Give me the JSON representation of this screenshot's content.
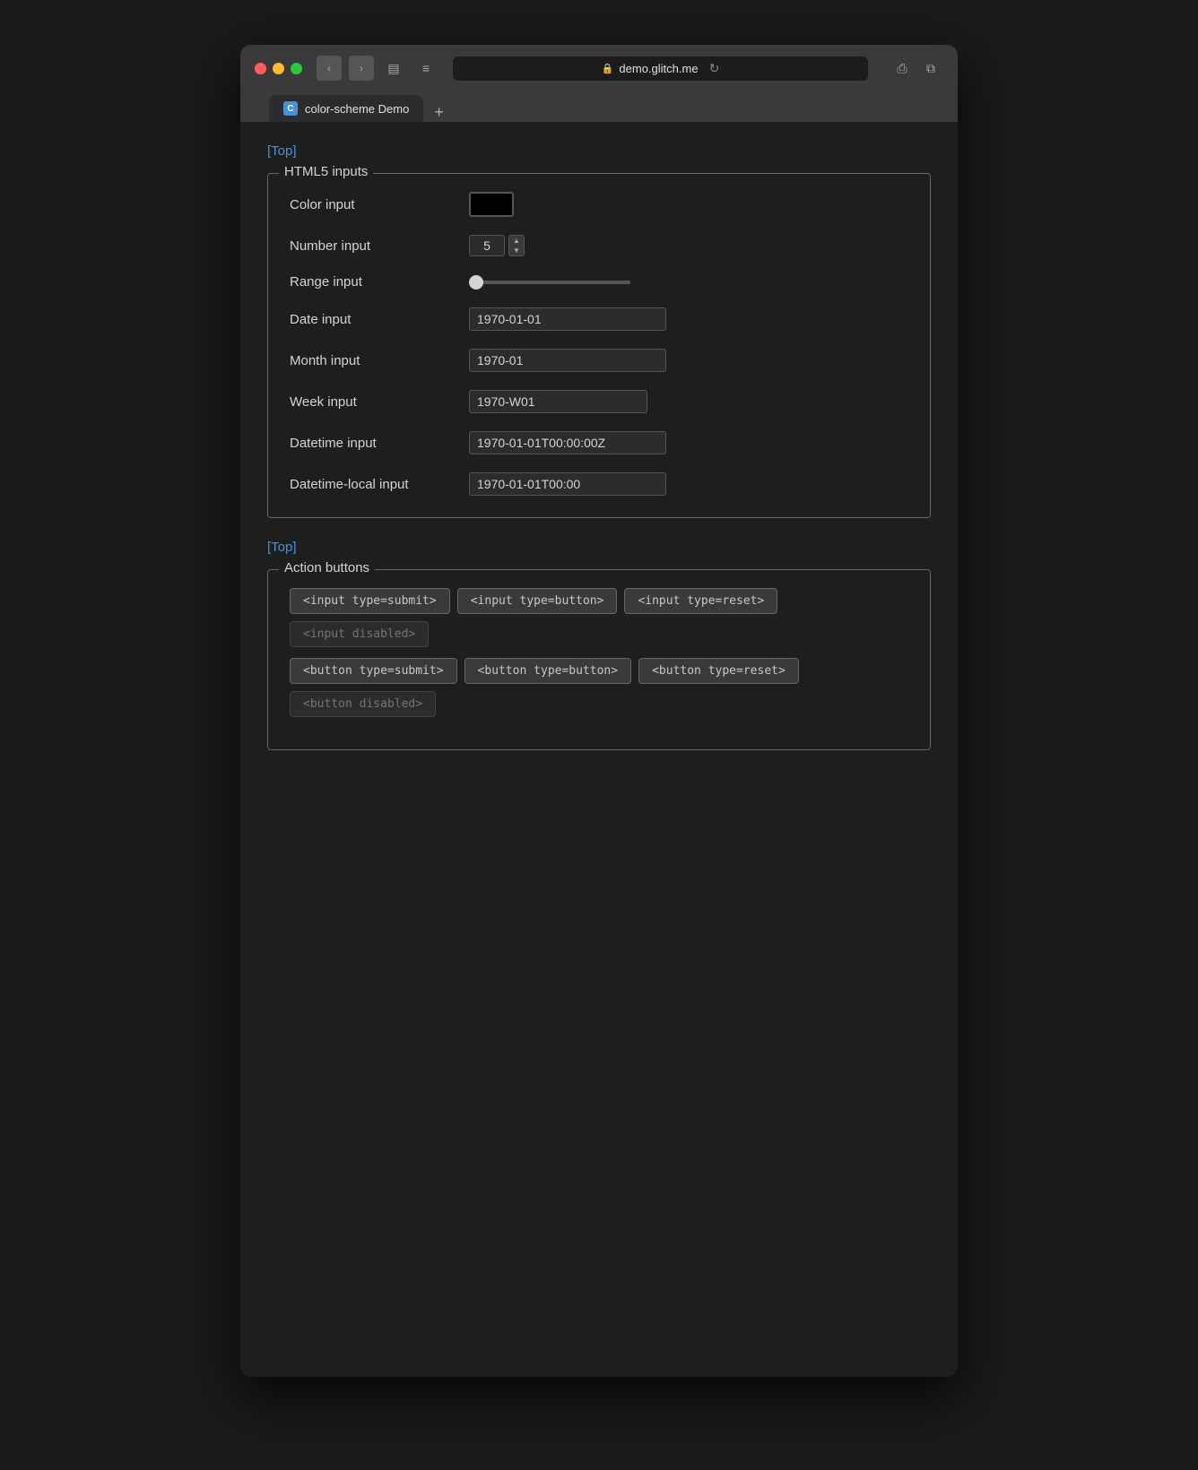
{
  "browser": {
    "url": "demo.glitch.me",
    "tab_title": "color-scheme Demo",
    "tab_favicon_letter": "C",
    "reload_symbol": "↻",
    "new_tab_symbol": "+"
  },
  "nav": {
    "back": "‹",
    "forward": "›",
    "sidebar": "▤",
    "menu": "≡"
  },
  "page": {
    "top_link": "[Top]",
    "top_link2": "[Top]",
    "html5_section_legend": "HTML5 inputs",
    "action_section_legend": "Action buttons",
    "inputs": {
      "color_label": "Color input",
      "color_value": "#000000",
      "number_label": "Number input",
      "number_value": "5",
      "range_label": "Range input",
      "range_value": "0",
      "date_label": "Date input",
      "date_value": "1970-01-01",
      "month_label": "Month input",
      "month_value": "1970-01",
      "week_label": "Week input",
      "week_value": "1970-W01",
      "datetime_label": "Datetime input",
      "datetime_value": "1970-01-01T00:00:00Z",
      "datetime_local_label": "Datetime-local input",
      "datetime_local_value": "1970-01-01T00:00"
    },
    "action_buttons": {
      "input_submit_label": "<input type=submit>",
      "input_button_label": "<input type=button>",
      "input_reset_label": "<input type=reset>",
      "input_disabled_label": "<input disabled>",
      "button_submit_label": "<button type=submit>",
      "button_button_label": "<button type=button>",
      "button_reset_label": "<button type=reset>",
      "button_disabled_label": "<button disabled>"
    }
  }
}
